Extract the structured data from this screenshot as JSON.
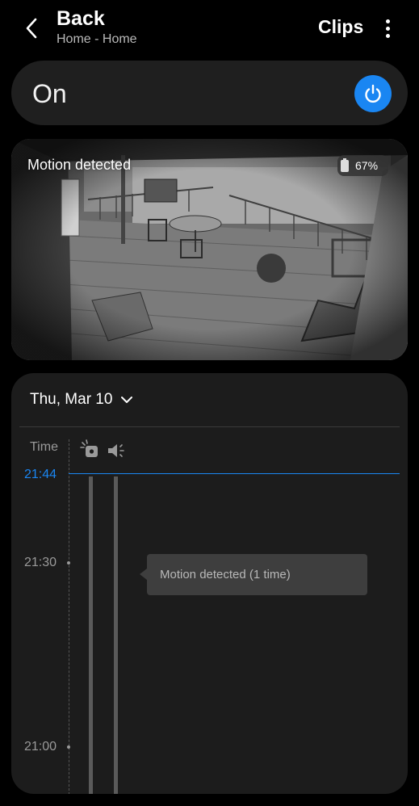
{
  "header": {
    "title": "Back",
    "subtitle": "Home - Home",
    "clips_label": "Clips",
    "icons": {
      "back": "chevron-left-icon",
      "more": "more-vertical-icon"
    }
  },
  "power": {
    "label": "On",
    "state": true,
    "accent": "#1a86f2",
    "icon": "power-icon"
  },
  "camera": {
    "motion_label": "Motion detected",
    "battery_label": "67%",
    "battery_level": 0.67
  },
  "history": {
    "date": "Thu, Mar 10",
    "time_header": "Time",
    "now_time": "21:44",
    "ticks": [
      "21:30",
      "21:00"
    ],
    "track_icons": [
      "motion-sensor-icon",
      "speaker-icon"
    ],
    "tooltip": "Motion detected (1 time)"
  }
}
